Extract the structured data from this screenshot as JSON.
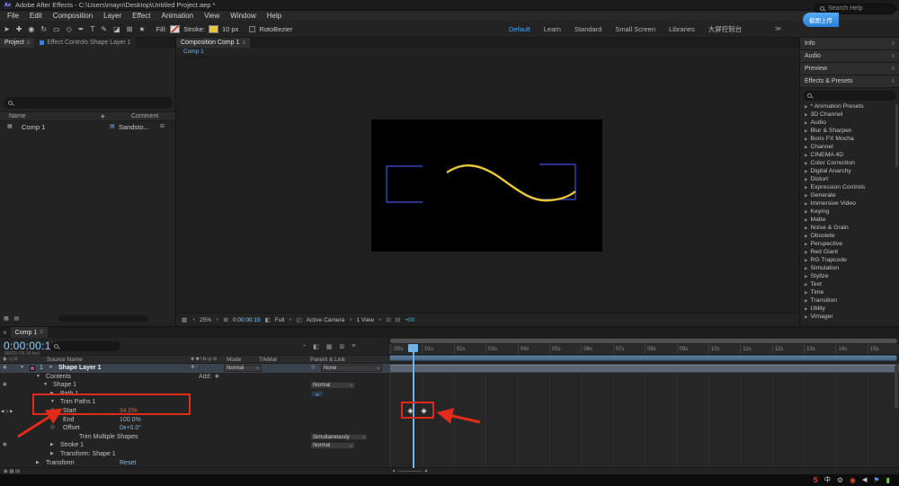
{
  "colors": {
    "annotation_red": "#e02a1a",
    "stroke_yellow": "#e5c73c",
    "path_blue": "#4150e0",
    "timecode_blue": "#8ccaf8",
    "value_blue": "#90b4de",
    "start_value": "#d4633c",
    "playhead_blue": "#70b2ea",
    "workspace_active": "#4da3f0",
    "selected_row": "#3a424e"
  },
  "icons": {
    "menu": "≡",
    "close": "×",
    "caret": "∨",
    "twirl_open": "▼",
    "twirl_closed": "▶",
    "eye": "◉",
    "stopwatch": "◷",
    "pickwhip": "◎",
    "shape_star": "★",
    "add": "◉",
    "kf_prev": "◀",
    "kf_next": "▶",
    "kf_diamond": "◇",
    "list_chevron": "▶",
    "comp_item": "▦",
    "folder": "▤",
    "flowchart": "⊞",
    "tag": "◈",
    "clock": "◔",
    "half": "◧",
    "grid": "▦",
    "grid_plus": "⊞",
    "region": "⊡",
    "quadrant": "◰",
    "minus_box": "⊟",
    "waves": "≋",
    "zoom_out": "▴",
    "zoom_in": "▲",
    "more": "≫",
    "switch_cluster": "✚ ✱ \\ fx ◎ ⊘",
    "layer_switches": "✚ /",
    "av_cluster": "◉ ◁ ⊙",
    "footer_cluster": "◉ ▦ ▤"
  },
  "titlebar": {
    "app_icon": "Ae",
    "title": "Adobe After Effects - C:\\Users\\mayn\\Desktop\\Untitled Project.aep *"
  },
  "menubar": {
    "items": [
      "File",
      "Edit",
      "Composition",
      "Layer",
      "Effect",
      "Animation",
      "View",
      "Window",
      "Help"
    ]
  },
  "toolbar": {
    "tools": [
      "➤",
      "✚",
      "◉",
      "↻",
      "▭",
      "◇",
      "✒",
      "T",
      "✎",
      "◪",
      "⊞",
      "★"
    ],
    "fill_label": "Fill:",
    "stroke_label": "Stroke:",
    "stroke_width": "10 px",
    "rotobezier_label": "RotoBezier",
    "workspaces": [
      "Default",
      "Learn",
      "Standard",
      "Small Screen",
      "Libraries",
      "大屏控制台"
    ],
    "search_placeholder": "Search Help",
    "upload_badge": "截图上传"
  },
  "project_panel": {
    "tab_project": "Project",
    "tab_effect_controls": "Effect Controls Shape Layer 1",
    "name_column": "Name",
    "comment_column": "Comment",
    "item_comp": "Comp 1",
    "item_secondary": "Sandsto..."
  },
  "composition_panel": {
    "tab": "Composition Comp 1",
    "viewer_tab": "Comp 1",
    "zoom": "25%",
    "timecode": "0:00:00:15",
    "resolution": "Full",
    "camera": "Active Camera",
    "views": "1 View",
    "exposure": "+00"
  },
  "right_panels": {
    "info_title": "Info",
    "audio_title": "Audio",
    "preview_title": "Preview",
    "effects_title": "Effects & Presets",
    "categories": [
      "* Animation Presets",
      "3D Channel",
      "Audio",
      "Blur & Sharpen",
      "Boris FX Mocha",
      "Channel",
      "CINEMA 4D",
      "Color Correction",
      "Digital Anarchy",
      "Distort",
      "Expression Controls",
      "Generate",
      "Immersive Video",
      "Keying",
      "Matte",
      "Noise & Grain",
      "Obsolete",
      "Perspective",
      "Red Giant",
      "RG Trapcode",
      "Simulation",
      "Stylize",
      "Text",
      "Time",
      "Transition",
      "Utility",
      "Vimager"
    ]
  },
  "timeline": {
    "tab": "Comp 1",
    "timecode": "0:00:00:15",
    "timecode_sub": "00015 (25.00 fps)",
    "source_name_col": "Source Name",
    "mode_col": "Mode",
    "trkmat_col": "TrkMat",
    "parent_col": "Parent & Link",
    "layer_index": "1",
    "layer_name": "Shape Layer 1",
    "layer_mode": "Normal",
    "layer_parent": "None",
    "add_label": "Add:",
    "properties": [
      {
        "label": "Contents"
      },
      {
        "label": "Shape 1",
        "value": "Normal"
      },
      {
        "label": "Path 1"
      },
      {
        "label": "Trim Paths 1"
      },
      {
        "label": "Start",
        "value": "34.0%"
      },
      {
        "label": "End",
        "value": "100.0%"
      },
      {
        "label": "Offset",
        "value": "0x+0.0°"
      },
      {
        "label": "Trim Multiple Shapes",
        "value": "Simultaneously"
      },
      {
        "label": "Stroke 1",
        "value": "Normal"
      },
      {
        "label": "Transform: Shape 1"
      },
      {
        "label": "Transform",
        "value": "Reset"
      }
    ],
    "ruler": [
      ":00s",
      "01s",
      "02s",
      "03s",
      "04s",
      "05s",
      "06s",
      "07s",
      "08s",
      "09s",
      "10s",
      "11s",
      "12s",
      "13s",
      "14s",
      "15s"
    ],
    "keyframe_count": 2
  },
  "taskbar": {
    "tray": [
      {
        "name": "sogou-input",
        "glyph": "S"
      },
      {
        "name": "chinese-input",
        "glyph": "中"
      },
      {
        "name": "settings",
        "glyph": "⚙"
      },
      {
        "name": "record",
        "glyph": "◉"
      },
      {
        "name": "volume",
        "glyph": "◀"
      },
      {
        "name": "network",
        "glyph": "⚑"
      },
      {
        "name": "battery",
        "glyph": "▮"
      }
    ]
  }
}
